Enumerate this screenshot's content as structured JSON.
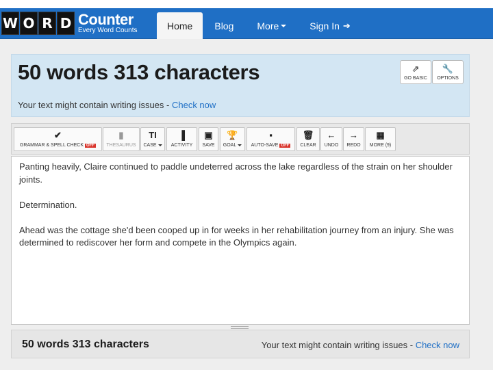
{
  "logo": {
    "letters": [
      "W",
      "O",
      "R",
      "D"
    ],
    "title": "Counter",
    "subtitle": "Every Word Counts"
  },
  "nav": {
    "items": [
      "Home",
      "Blog",
      "More",
      "Sign In"
    ],
    "active": "Home"
  },
  "header": {
    "title": "50 words 313 characters",
    "warning_text": "Your text might contain writing issues - ",
    "warning_link": "Check now",
    "buttons": [
      {
        "label": "GO BASIC",
        "icon": "external-link-icon"
      },
      {
        "label": "OPTIONS",
        "icon": "wrench-icon"
      }
    ]
  },
  "toolbar": {
    "grammar": "GRAMMAR & SPELL CHECK",
    "grammar_state": "OFF",
    "thesaurus": "THESAURUS",
    "case": "CASE",
    "activity": "ACTIVITY",
    "save": "SAVE",
    "goal": "GOAL",
    "autosave": "AUTO-SAVE",
    "autosave_state": "OFF",
    "clear": "CLEAR",
    "undo": "UNDO",
    "redo": "REDO",
    "more": "MORE (9)"
  },
  "editor": {
    "paragraphs": [
      "Panting heavily, Claire continued to paddle undeterred across the lake regardless of the strain on her shoulder joints.",
      "Determination.",
      "Ahead was the cottage she'd been cooped up in for weeks in her rehabilitation journey from an injury. She was determined to rediscover her form and compete in the Olympics again."
    ]
  },
  "footer": {
    "count": "50 words 313 characters",
    "warning_text": "Your text might contain writing issues - ",
    "warning_link": "Check now"
  },
  "colors": {
    "brand": "#1f6fc5",
    "header_bg": "#d3e6f3",
    "off_badge": "#d9342b"
  }
}
